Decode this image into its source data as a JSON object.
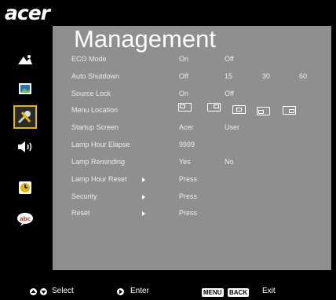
{
  "brand": {
    "logo_text": "acer"
  },
  "menu": {
    "title": "Management"
  },
  "sidebar": {
    "items": [
      {
        "icon": "picture-icon"
      },
      {
        "icon": "image-icon"
      },
      {
        "icon": "wrench-icon",
        "active": true
      },
      {
        "icon": "speaker-icon"
      },
      {
        "icon": "timer-icon"
      },
      {
        "icon": "language-icon"
      }
    ]
  },
  "settings": {
    "eco_mode": {
      "label": "ECO Mode",
      "options": [
        "On",
        "Off"
      ]
    },
    "auto_shutdown": {
      "label": "Auto Shutdown",
      "options": [
        "Off",
        "15",
        "30",
        "60"
      ]
    },
    "source_lock": {
      "label": "Source Lock",
      "options": [
        "On",
        "Off"
      ]
    },
    "menu_location": {
      "label": "Menu Location"
    },
    "startup_screen": {
      "label": "Startup Screen",
      "options": [
        "Acer",
        "User"
      ]
    },
    "lamp_hour_elapse": {
      "label": "Lamp Hour Elapse",
      "value": "9999"
    },
    "lamp_reminding": {
      "label": "Lamp Reminding",
      "options": [
        "Yes",
        "No"
      ]
    },
    "lamp_hour_reset": {
      "label": "Lamp Hour Reset",
      "action": "Press"
    },
    "security": {
      "label": "Security",
      "action": "Press"
    },
    "reset": {
      "label": "Reset",
      "action": "Press"
    }
  },
  "footer": {
    "select": "Select",
    "enter": "Enter",
    "menu_key": "MENU",
    "back_key": "BACK",
    "exit": "Exit"
  },
  "colors": {
    "panel": "#8f8f8f",
    "accent": "#e4b600",
    "background": "#000000"
  }
}
